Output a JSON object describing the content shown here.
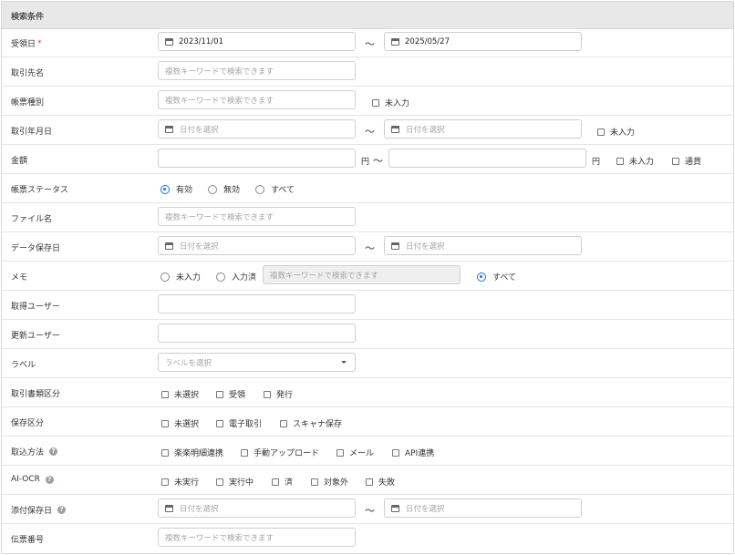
{
  "header": {
    "title": "検索条件"
  },
  "ph": {
    "keyword": "複数キーワードで検索できます",
    "date": "日付を選択",
    "label": "ラベルを選択"
  },
  "sym": {
    "tilde": "〜",
    "yen": "円"
  },
  "labels": {
    "received_date": "受領日",
    "required_mark": "*",
    "partner": "取引先名",
    "doc_type": "帳票種別",
    "txn_date": "取引年月日",
    "amount": "金額",
    "status": "帳票ステータス",
    "file_name": "ファイル名",
    "saved_date": "データ保存日",
    "memo": "メモ",
    "creator": "取得ユーザー",
    "updater": "更新ユーザー",
    "label": "ラベル",
    "doc_category": "取引書類区分",
    "storage_category": "保存区分",
    "import_method": "取込方法",
    "ai_ocr": "AI-OCR",
    "attach_date": "添付保存日",
    "slip_no": "伝票番号"
  },
  "values": {
    "received_from": "2023/11/01",
    "received_to": "2025/05/27"
  },
  "options": {
    "not_entered": "未入力",
    "currency": "通貨",
    "status": [
      "有効",
      "無効",
      "すべて"
    ],
    "status_selected": "有効",
    "memo": [
      "未入力",
      "入力済",
      "すべて"
    ],
    "memo_selected": "すべて",
    "doc_category": [
      "未選択",
      "受領",
      "発行"
    ],
    "storage_category": [
      "未選択",
      "電子取引",
      "スキャナ保存"
    ],
    "import_method": [
      "楽楽明細連携",
      "手動アップロード",
      "メール",
      "API連携"
    ],
    "ai_ocr": [
      "未実行",
      "実行中",
      "済",
      "対象外",
      "失敗"
    ]
  },
  "colors": {
    "accent": "#1a73e8",
    "required": "#e53935",
    "header_bg": "#e8e8e8"
  }
}
